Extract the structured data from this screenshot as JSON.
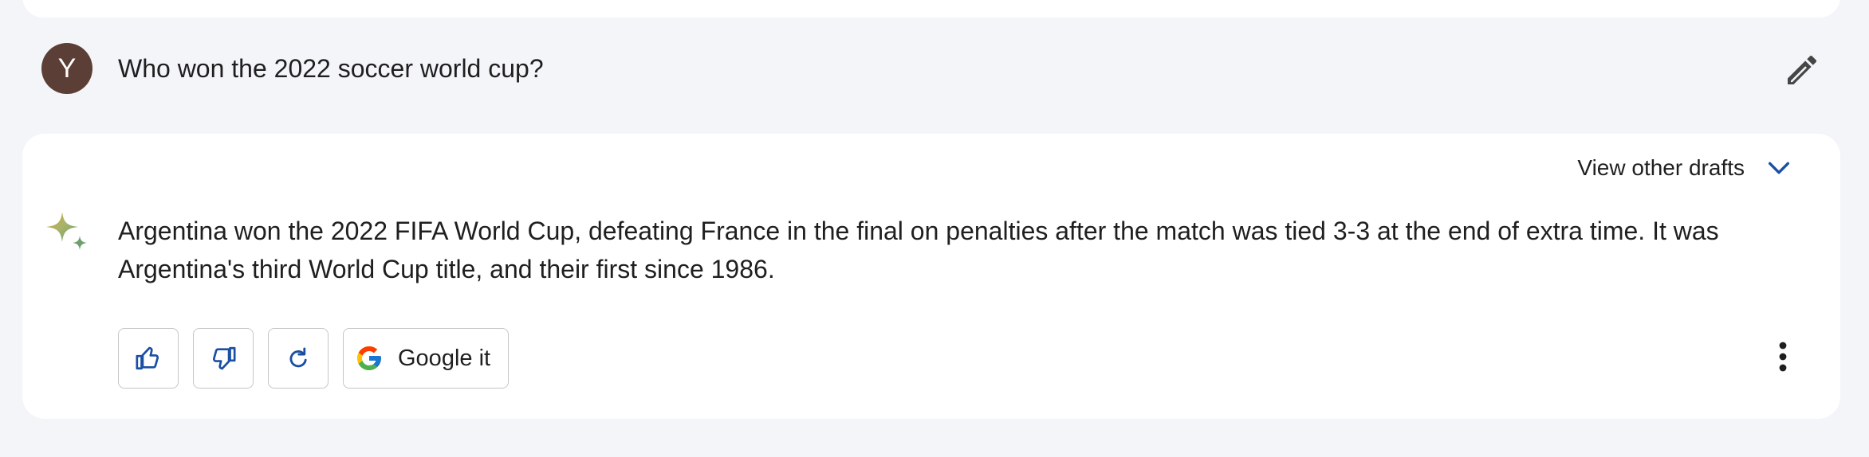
{
  "user": {
    "avatar_initial": "Y",
    "query": "Who won the 2022 soccer world cup?"
  },
  "response": {
    "view_drafts_label": "View other drafts",
    "text": "Argentina won the 2022 FIFA World Cup, defeating France in the final on penalties after the match was tied 3-3 at the end of extra time. It was Argentina's third World Cup title, and their first since 1986.",
    "actions": {
      "google_it_label": "Google it"
    }
  },
  "colors": {
    "page_background": "#f4f5f9",
    "card_background": "#ffffff",
    "avatar_background": "#5b3e36",
    "accent_blue": "#1a4fa3",
    "button_border": "#c4c7c5"
  },
  "icons": {
    "edit": "pencil-icon",
    "drafts_toggle": "chevron-down-icon",
    "assistant": "sparkle-icon",
    "thumbs_up": "thumbs-up-icon",
    "thumbs_down": "thumbs-down-icon",
    "regenerate": "refresh-icon",
    "google": "google-g-icon",
    "more": "more-vert-icon"
  }
}
